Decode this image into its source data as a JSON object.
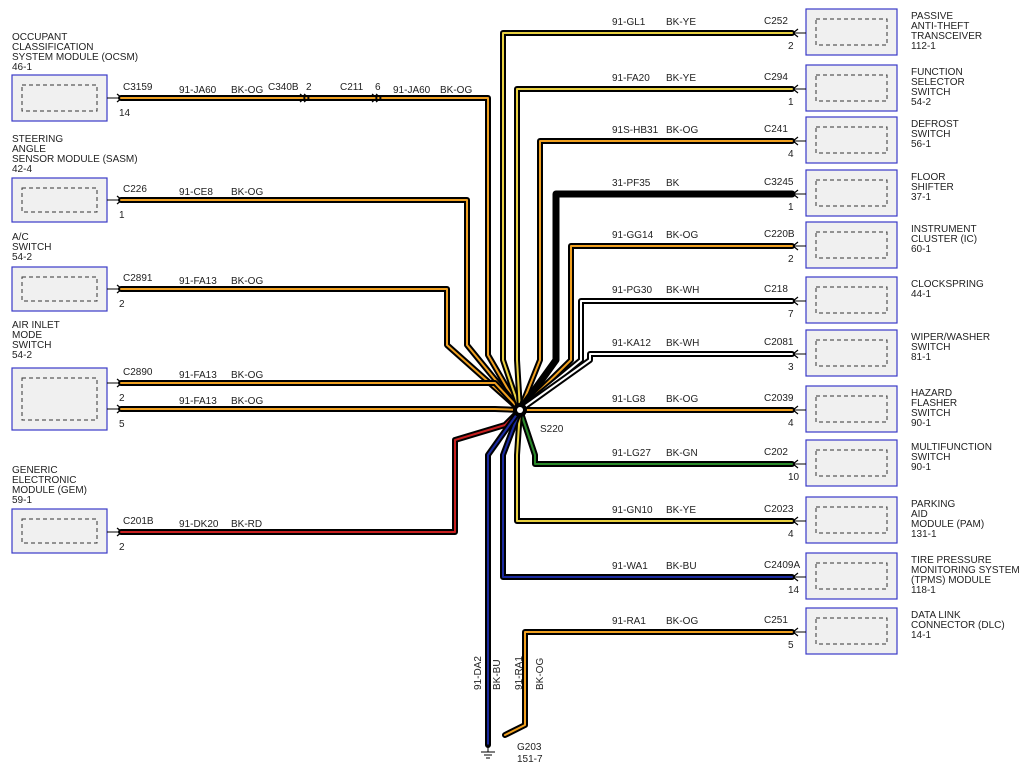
{
  "splice": {
    "id": "S220"
  },
  "ground": {
    "id": "G203",
    "ref": "151-7"
  },
  "colors": {
    "BK": "#000000",
    "OG": "#f0a020",
    "YE": "#e8d040",
    "WH": "#ffffff",
    "RD": "#c82020",
    "BU": "#1a2aa0",
    "GN": "#2a8a2a",
    "frame": "#3a3ac8"
  },
  "left_modules": [
    {
      "id": "ocsm",
      "name_lines": [
        "OCCUPANT",
        "CLASSIFICATION",
        "SYSTEM MODULE (OCSM)",
        "46-1"
      ],
      "circuits": [
        {
          "connector": "C3159",
          "pin": "14",
          "circuit": "91-JA60",
          "color": "BK-OG"
        }
      ],
      "inline": [
        {
          "connector": "C340B",
          "pin": "2"
        },
        {
          "connector": "C211",
          "pin": "6"
        }
      ],
      "circuit2": {
        "circuit": "91-JA60",
        "color": "BK-OG"
      }
    },
    {
      "id": "sasm",
      "name_lines": [
        "STEERING",
        "ANGLE",
        "SENSOR MODULE (SASM)",
        "42-4"
      ],
      "circuits": [
        {
          "connector": "C226",
          "pin": "1",
          "circuit": "91-CE8",
          "color": "BK-OG"
        }
      ]
    },
    {
      "id": "ac",
      "name_lines": [
        "A/C",
        "SWITCH",
        "54-2"
      ],
      "circuits": [
        {
          "connector": "C2891",
          "pin": "2",
          "circuit": "91-FA13",
          "color": "BK-OG"
        }
      ]
    },
    {
      "id": "airinlet",
      "name_lines": [
        "AIR INLET",
        "MODE",
        "SWITCH",
        "54-2"
      ],
      "circuits": [
        {
          "connector": "C2890",
          "pin": "2",
          "circuit": "91-FA13",
          "color": "BK-OG"
        },
        {
          "connector": "",
          "pin": "5",
          "circuit": "91-FA13",
          "color": "BK-OG"
        }
      ]
    },
    {
      "id": "gem",
      "name_lines": [
        "GENERIC",
        "ELECTRONIC",
        "MODULE (GEM)",
        "59-1"
      ],
      "circuits": [
        {
          "connector": "C201B",
          "pin": "2",
          "circuit": "91-DK20",
          "color": "BK-RD"
        }
      ]
    }
  ],
  "right_modules": [
    {
      "id": "pats",
      "name_lines": [
        "PASSIVE",
        "ANTI-THEFT",
        "TRANSCEIVER",
        "112-1"
      ],
      "connector": "C252",
      "pin": "2",
      "circuit": "91-GL1",
      "color": "BK-YE"
    },
    {
      "id": "fss",
      "name_lines": [
        "FUNCTION",
        "SELECTOR",
        "SWITCH",
        "54-2"
      ],
      "connector": "C294",
      "pin": "1",
      "circuit": "91-FA20",
      "color": "BK-YE"
    },
    {
      "id": "defrost",
      "name_lines": [
        "DEFROST",
        "SWITCH",
        "56-1"
      ],
      "connector": "C241",
      "pin": "4",
      "circuit": "91S-HB31",
      "color": "BK-OG"
    },
    {
      "id": "floor",
      "name_lines": [
        "FLOOR",
        "SHIFTER",
        "37-1"
      ],
      "connector": "C3245",
      "pin": "1",
      "circuit": "31-PF35",
      "color": "BK"
    },
    {
      "id": "ic",
      "name_lines": [
        "INSTRUMENT",
        "CLUSTER (IC)",
        "60-1"
      ],
      "connector": "C220B",
      "pin": "2",
      "circuit": "91-GG14",
      "color": "BK-OG"
    },
    {
      "id": "clock",
      "name_lines": [
        "CLOCKSPRING",
        "44-1"
      ],
      "connector": "C218",
      "pin": "7",
      "circuit": "91-PG30",
      "color": "BK-WH"
    },
    {
      "id": "wiper",
      "name_lines": [
        "WIPER/WASHER",
        "SWITCH",
        "81-1"
      ],
      "connector": "C2081",
      "pin": "3",
      "circuit": "91-KA12",
      "color": "BK-WH"
    },
    {
      "id": "hazard",
      "name_lines": [
        "HAZARD",
        "FLASHER",
        "SWITCH",
        "90-1"
      ],
      "connector": "C2039",
      "pin": "4",
      "circuit": "91-LG8",
      "color": "BK-OG"
    },
    {
      "id": "multi",
      "name_lines": [
        "MULTIFUNCTION",
        "SWITCH",
        "90-1"
      ],
      "connector": "C202",
      "pin": "10",
      "circuit": "91-LG27",
      "color": "BK-GN"
    },
    {
      "id": "pam",
      "name_lines": [
        "PARKING",
        "AID",
        "MODULE (PAM)",
        "131-1"
      ],
      "connector": "C2023",
      "pin": "4",
      "circuit": "91-GN10",
      "color": "BK-YE"
    },
    {
      "id": "tpms",
      "name_lines": [
        "TIRE PRESSURE",
        "MONITORING SYSTEM",
        "(TPMS) MODULE",
        "118-1"
      ],
      "connector": "C2409A",
      "pin": "14",
      "circuit": "91-WA1",
      "color": "BK-BU"
    },
    {
      "id": "dlc",
      "name_lines": [
        "DATA LINK",
        "CONNECTOR (DLC)",
        "14-1"
      ],
      "connector": "C251",
      "pin": "5",
      "circuit": "91-RA1",
      "color": "BK-OG"
    }
  ],
  "ground_wires": [
    {
      "circuit": "91-DA2",
      "color": "BK-BU"
    },
    {
      "circuit": "91-RA1",
      "color": "BK-OG"
    }
  ]
}
